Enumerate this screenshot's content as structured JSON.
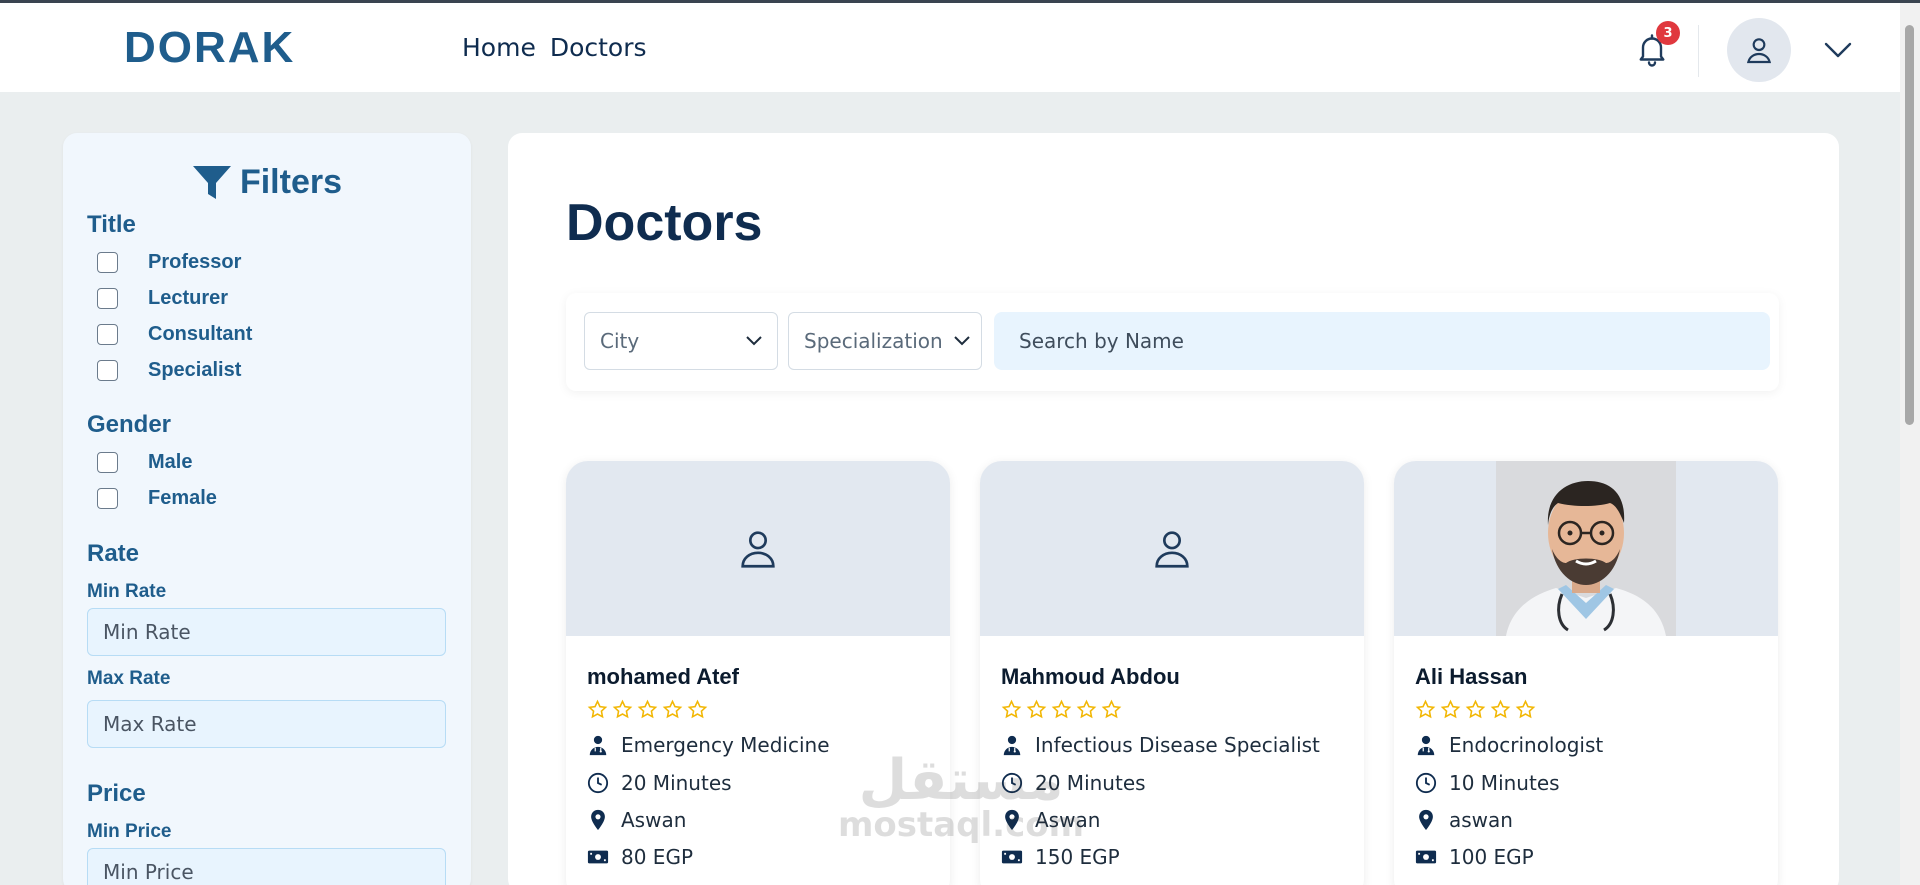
{
  "header": {
    "logo": "DORAK",
    "nav": [
      "Home",
      "Doctors"
    ],
    "notification_count": "3"
  },
  "sidebar": {
    "title": "Filters",
    "title_group": {
      "label": "Title",
      "options": [
        "Professor",
        "Lecturer",
        "Consultant",
        "Specialist"
      ]
    },
    "gender_group": {
      "label": "Gender",
      "options": [
        "Male",
        "Female"
      ]
    },
    "rate_group": {
      "label": "Rate",
      "min_label": "Min Rate",
      "min_placeholder": "Min Rate",
      "max_label": "Max Rate",
      "max_placeholder": "Max Rate"
    },
    "price_group": {
      "label": "Price",
      "min_label": "Min Price",
      "min_placeholder": "Min Price"
    }
  },
  "main": {
    "title": "Doctors",
    "city_select": "City",
    "specialization_select": "Specialization",
    "search_placeholder": "Search by Name"
  },
  "doctors": [
    {
      "name": "mohamed Atef",
      "specialty": "Emergency Medicine",
      "wait": "20 Minutes",
      "location": "Aswan",
      "price": "80 EGP",
      "rating": 0,
      "has_photo": false
    },
    {
      "name": "Mahmoud Abdou",
      "specialty": "Infectious Disease Specialist",
      "wait": "20 Minutes",
      "location": "Aswan",
      "price": "150 EGP",
      "rating": 0,
      "has_photo": false
    },
    {
      "name": "Ali Hassan",
      "specialty": "Endocrinologist",
      "wait": "10 Minutes",
      "location": "aswan",
      "price": "100 EGP",
      "rating": 0,
      "has_photo": true
    }
  ],
  "watermark": {
    "arabic": "مستقل",
    "latin": "mostaql.com"
  },
  "colors": {
    "brand": "#1f5d8c",
    "navy": "#0f2c4f",
    "star": "#f2b705",
    "badge": "#e0383e"
  },
  "icons": [
    "bell-icon",
    "user-icon",
    "chevron-down-icon",
    "funnel-icon",
    "doctor-icon",
    "clock-icon",
    "map-pin-icon",
    "money-icon",
    "star-icon"
  ]
}
